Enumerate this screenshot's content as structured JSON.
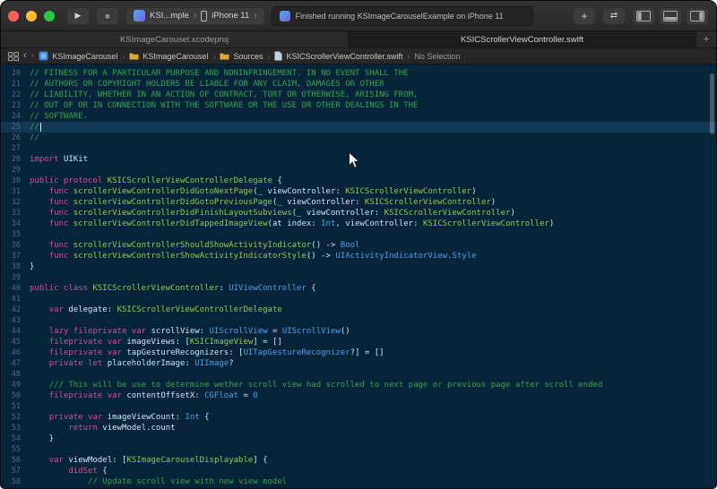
{
  "colors": {
    "editor_bg": "#062538",
    "editor_hl": "rgba(96,170,228,0.15)",
    "gutter": "#4d6b7d",
    "cm": "#32a44c",
    "kw": "#f0418f",
    "gr": "#95c843",
    "ty": "#41a1f0",
    "pl": "#cfe2f1",
    "accent_red": "#ff5f57",
    "accent_yellow": "#febc2e",
    "accent_green": "#28c840"
  },
  "toolbar": {
    "scheme_label": "KSI...mple",
    "device_label": "iPhone 11",
    "status_text": "Finished running KSImageCarouselExample on iPhone 11",
    "library_label": "+"
  },
  "tabbar": {
    "new_tab_label": "+"
  },
  "tabs": [
    {
      "label": "KSImageCarousel.xcodeproj",
      "active": false
    },
    {
      "label": "KSICScrollerViewController.swift",
      "active": true
    }
  ],
  "breadcrumb": {
    "items": [
      "KSImageCarousel",
      "KSImageCarousel",
      "Sources",
      "KSICScrollerViewController.swift",
      "No Selection"
    ]
  },
  "editor": {
    "cursor_line": 25,
    "lines": [
      {
        "n": 20,
        "s": [
          [
            "// FITNESS FOR A PARTICULAR PURPOSE AND NONINFRINGEMENT. IN NO EVENT SHALL THE",
            "cm"
          ]
        ]
      },
      {
        "n": 21,
        "s": [
          [
            "// AUTHORS OR COPYRIGHT HOLDERS BE LIABLE FOR ANY CLAIM, DAMAGES OR OTHER",
            "cm"
          ]
        ]
      },
      {
        "n": 22,
        "s": [
          [
            "// LIABILITY, WHETHER IN AN ACTION OF CONTRACT, TORT OR OTHERWISE, ARISING FROM,",
            "cm"
          ]
        ]
      },
      {
        "n": 23,
        "s": [
          [
            "// OUT OF OR IN CONNECTION WITH THE SOFTWARE OR THE USE OR OTHER DEALINGS IN THE",
            "cm"
          ]
        ]
      },
      {
        "n": 24,
        "s": [
          [
            "// SOFTWARE.",
            "cm"
          ]
        ]
      },
      {
        "n": 25,
        "s": [
          [
            "//",
            "cm"
          ]
        ],
        "hl": true,
        "cursor": true
      },
      {
        "n": 26,
        "s": [
          [
            "//",
            "cm"
          ]
        ]
      },
      {
        "n": 27,
        "s": []
      },
      {
        "n": 28,
        "s": [
          [
            "import ",
            "kw"
          ],
          [
            "UIKit",
            "pl"
          ]
        ]
      },
      {
        "n": 29,
        "s": []
      },
      {
        "n": 30,
        "s": [
          [
            "public protocol ",
            "kw"
          ],
          [
            "KSICScrollerViewControllerDelegate",
            "gr"
          ],
          [
            " {",
            "pl"
          ]
        ]
      },
      {
        "n": 31,
        "s": [
          [
            "    ",
            "pl"
          ],
          [
            "func ",
            "kw"
          ],
          [
            "scrollerViewControllerDidGotoNextPage",
            "gr"
          ],
          [
            "(_ viewController: ",
            "pl"
          ],
          [
            "KSICScrollerViewController",
            "gr"
          ],
          [
            ")",
            "pl"
          ]
        ]
      },
      {
        "n": 32,
        "s": [
          [
            "    ",
            "pl"
          ],
          [
            "func ",
            "kw"
          ],
          [
            "scrollerViewControllerDidGotoPreviousPage",
            "gr"
          ],
          [
            "(_ viewController: ",
            "pl"
          ],
          [
            "KSICScrollerViewController",
            "gr"
          ],
          [
            ")",
            "pl"
          ]
        ]
      },
      {
        "n": 33,
        "s": [
          [
            "    ",
            "pl"
          ],
          [
            "func ",
            "kw"
          ],
          [
            "scrollerViewControllerDidFinishLayoutSubviews",
            "gr"
          ],
          [
            "(_ viewController: ",
            "pl"
          ],
          [
            "KSICScrollerViewController",
            "gr"
          ],
          [
            ")",
            "pl"
          ]
        ]
      },
      {
        "n": 34,
        "s": [
          [
            "    ",
            "pl"
          ],
          [
            "func ",
            "kw"
          ],
          [
            "scrollerViewControllerDidTappedImageView",
            "gr"
          ],
          [
            "(at index: ",
            "pl"
          ],
          [
            "Int",
            "ty"
          ],
          [
            ", viewController: ",
            "pl"
          ],
          [
            "KSICScrollerViewController",
            "gr"
          ],
          [
            ")",
            "pl"
          ]
        ]
      },
      {
        "n": 35,
        "s": []
      },
      {
        "n": 36,
        "s": [
          [
            "    ",
            "pl"
          ],
          [
            "func ",
            "kw"
          ],
          [
            "scrollerViewControllerShouldShowActivityIndicator",
            "gr"
          ],
          [
            "() -> ",
            "pl"
          ],
          [
            "Bool",
            "ty"
          ]
        ]
      },
      {
        "n": 37,
        "s": [
          [
            "    ",
            "pl"
          ],
          [
            "func ",
            "kw"
          ],
          [
            "scrollerViewControllerShowActivityIndicatorStyle",
            "gr"
          ],
          [
            "() -> ",
            "pl"
          ],
          [
            "UIActivityIndicatorView.Style",
            "ty"
          ]
        ]
      },
      {
        "n": 38,
        "s": [
          [
            "}",
            "pl"
          ]
        ]
      },
      {
        "n": 39,
        "s": []
      },
      {
        "n": 40,
        "s": [
          [
            "public class ",
            "kw"
          ],
          [
            "KSICScrollerViewController",
            "gr"
          ],
          [
            ": ",
            "pl"
          ],
          [
            "UIViewController",
            "ty"
          ],
          [
            " {",
            "pl"
          ]
        ]
      },
      {
        "n": 41,
        "s": []
      },
      {
        "n": 42,
        "s": [
          [
            "    ",
            "pl"
          ],
          [
            "var ",
            "kw"
          ],
          [
            "delegate: ",
            "pl"
          ],
          [
            "KSICScrollerViewControllerDelegate",
            "gr"
          ]
        ]
      },
      {
        "n": 43,
        "s": []
      },
      {
        "n": 44,
        "s": [
          [
            "    ",
            "pl"
          ],
          [
            "lazy fileprivate var ",
            "kw"
          ],
          [
            "scrollView: ",
            "pl"
          ],
          [
            "UIScrollView",
            "ty"
          ],
          [
            " = ",
            "pl"
          ],
          [
            "UIScrollView",
            "ty"
          ],
          [
            "()",
            "pl"
          ]
        ]
      },
      {
        "n": 45,
        "s": [
          [
            "    ",
            "pl"
          ],
          [
            "fileprivate var ",
            "kw"
          ],
          [
            "imageViews: [",
            "pl"
          ],
          [
            "KSICImageView",
            "gr"
          ],
          [
            "] = []",
            "pl"
          ]
        ]
      },
      {
        "n": 46,
        "s": [
          [
            "    ",
            "pl"
          ],
          [
            "fileprivate var ",
            "kw"
          ],
          [
            "tapGestureRecognizers: [",
            "pl"
          ],
          [
            "UITapGestureRecognizer",
            "ty"
          ],
          [
            "?] = []",
            "pl"
          ]
        ]
      },
      {
        "n": 47,
        "s": [
          [
            "    ",
            "pl"
          ],
          [
            "private let ",
            "kw"
          ],
          [
            "placeholderImage: ",
            "pl"
          ],
          [
            "UIImage",
            "ty"
          ],
          [
            "?",
            "pl"
          ]
        ]
      },
      {
        "n": 48,
        "s": []
      },
      {
        "n": 49,
        "s": [
          [
            "    ",
            "pl"
          ],
          [
            "/// This will be use to determine wether scroll view had scrolled to next page or previous page after scroll ended",
            "cm"
          ]
        ]
      },
      {
        "n": 50,
        "s": [
          [
            "    ",
            "pl"
          ],
          [
            "fileprivate var ",
            "kw"
          ],
          [
            "contentOffsetX: ",
            "pl"
          ],
          [
            "CGFloat",
            "ty"
          ],
          [
            " = ",
            "pl"
          ],
          [
            "0",
            "ty"
          ]
        ]
      },
      {
        "n": 51,
        "s": []
      },
      {
        "n": 52,
        "s": [
          [
            "    ",
            "pl"
          ],
          [
            "private var ",
            "kw"
          ],
          [
            "imageViewCount: ",
            "pl"
          ],
          [
            "Int",
            "ty"
          ],
          [
            " {",
            "pl"
          ]
        ]
      },
      {
        "n": 53,
        "s": [
          [
            "        ",
            "pl"
          ],
          [
            "return ",
            "kw"
          ],
          [
            "viewModel.count",
            "pl"
          ]
        ]
      },
      {
        "n": 54,
        "s": [
          [
            "    }",
            "pl"
          ]
        ]
      },
      {
        "n": 55,
        "s": []
      },
      {
        "n": 56,
        "s": [
          [
            "    ",
            "pl"
          ],
          [
            "var ",
            "kw"
          ],
          [
            "viewModel: [",
            "pl"
          ],
          [
            "KSImageCarouselDisplayable",
            "gr"
          ],
          [
            "] {",
            "pl"
          ]
        ]
      },
      {
        "n": 57,
        "s": [
          [
            "        ",
            "pl"
          ],
          [
            "didSet",
            "kw"
          ],
          [
            " {",
            "pl"
          ]
        ]
      },
      {
        "n": 58,
        "s": [
          [
            "            ",
            "pl"
          ],
          [
            "// Update scroll view with new view model",
            "cm"
          ]
        ]
      }
    ]
  }
}
